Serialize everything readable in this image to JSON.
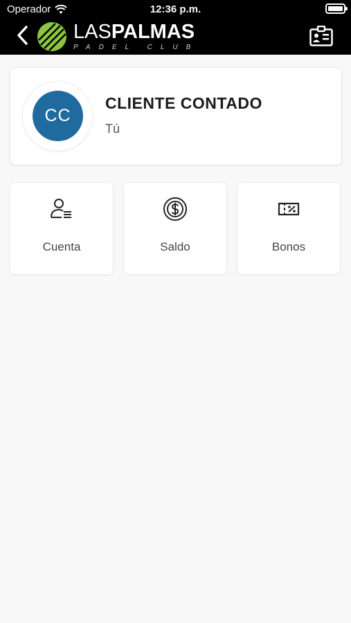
{
  "status_bar": {
    "carrier": "Operador",
    "time": "12:36 p.m."
  },
  "header": {
    "logo_text_light": "LAS",
    "logo_text_bold": "PALMAS",
    "logo_subtitle": "PADEL CLUB",
    "back_icon": "chevron-left-icon",
    "card_icon": "id-card-icon"
  },
  "profile": {
    "initials": "CC",
    "name": "CLIENTE CONTADO",
    "subtitle": "Tú",
    "avatar_color": "#1f6a9e"
  },
  "tiles": [
    {
      "label": "Cuenta",
      "icon": "user-list-icon"
    },
    {
      "label": "Saldo",
      "icon": "coin-dollar-icon"
    },
    {
      "label": "Bonos",
      "icon": "voucher-percent-icon"
    }
  ],
  "colors": {
    "accent": "#1f6a9e",
    "logo_green": "#8cc63f",
    "header_bg": "#000000"
  }
}
